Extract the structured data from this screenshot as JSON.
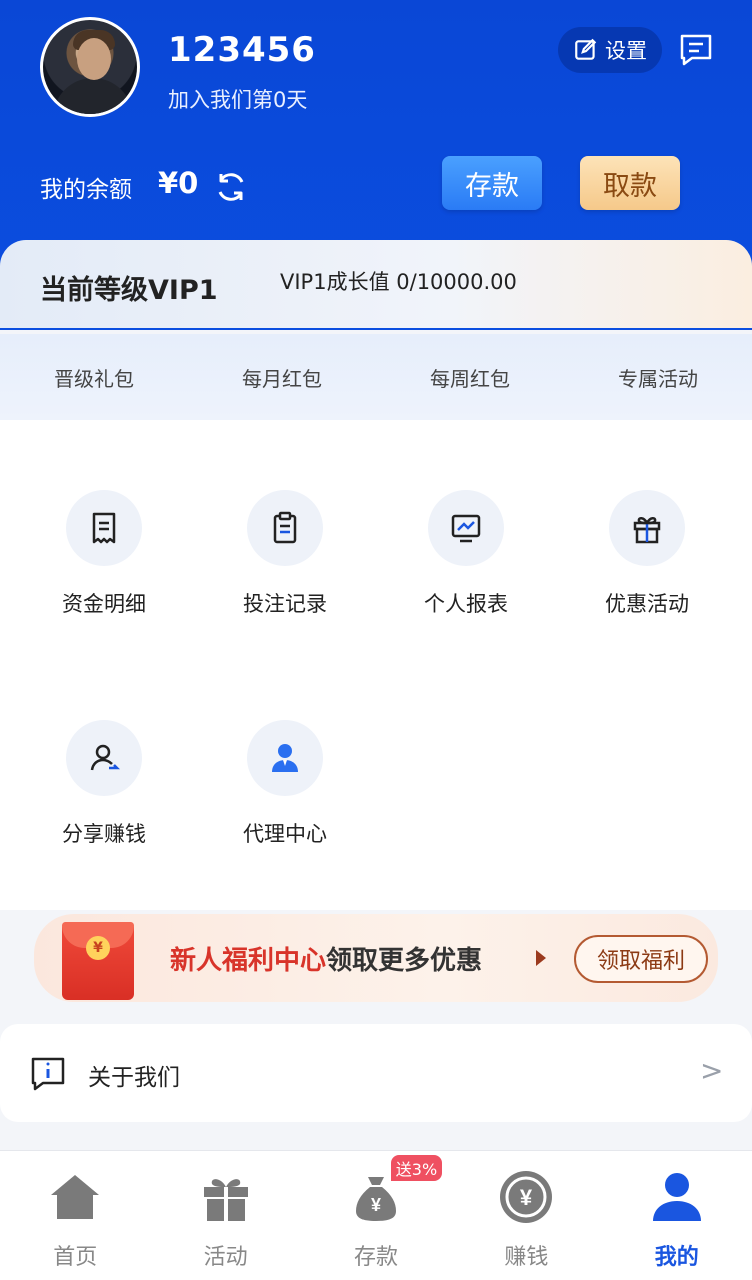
{
  "header": {
    "username": "123456",
    "join_text": "加入我们第0天",
    "settings_label": "设置",
    "balance_label": "我的余额",
    "balance_value": "¥0",
    "deposit_label": "存款",
    "withdraw_label": "取款"
  },
  "vip": {
    "level": "当前等级VIP1",
    "growth": "VIP1成长值 0/10000.00"
  },
  "perks": [
    "晋级礼包",
    "每月红包",
    "每周红包",
    "专属活动"
  ],
  "grid": [
    {
      "label": "资金明细",
      "icon": "bill-icon"
    },
    {
      "label": "投注记录",
      "icon": "clipboard-icon"
    },
    {
      "label": "个人报表",
      "icon": "report-icon"
    },
    {
      "label": "优惠活动",
      "icon": "gift-icon"
    },
    {
      "label": "分享赚钱",
      "icon": "share-user-icon"
    },
    {
      "label": "代理中心",
      "icon": "agent-icon"
    }
  ],
  "promo": {
    "highlight": "新人福利中心",
    "text": "领取更多优惠",
    "button": "领取福利",
    "coin": "¥"
  },
  "about": {
    "label": "关于我们",
    "arrow": ">"
  },
  "nav": {
    "items": [
      {
        "label": "首页",
        "icon": "home-icon"
      },
      {
        "label": "活动",
        "icon": "gift-icon"
      },
      {
        "label": "存款",
        "icon": "money-bag-icon",
        "badge": "送3%"
      },
      {
        "label": "赚钱",
        "icon": "yuan-coin-icon"
      },
      {
        "label": "我的",
        "icon": "user-icon",
        "active": true
      }
    ]
  },
  "colors": {
    "brand_blue": "#0b4ee0",
    "accent_red": "#d8342a",
    "withdraw_gold": "#f5c98a"
  }
}
